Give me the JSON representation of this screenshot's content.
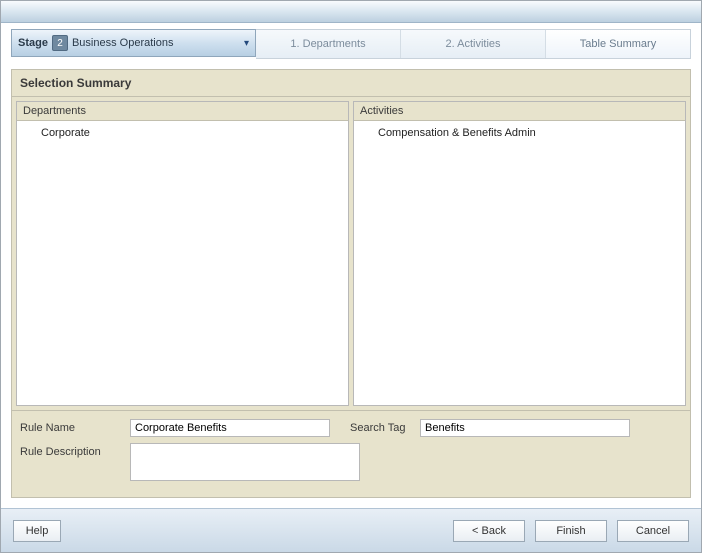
{
  "stage": {
    "label": "Stage",
    "number": "2",
    "text": "Business Operations"
  },
  "breadcrumbs": [
    {
      "label": "1. Departments",
      "active": false
    },
    {
      "label": "2. Activities",
      "active": false
    },
    {
      "label": "Table Summary",
      "active": true
    }
  ],
  "section_title": "Selection Summary",
  "columns": {
    "departments": {
      "header": "Departments",
      "items": [
        "Corporate"
      ]
    },
    "activities": {
      "header": "Activities",
      "items": [
        "Compensation & Benefits Admin"
      ]
    }
  },
  "form": {
    "rule_name_label": "Rule Name",
    "rule_name_value": "Corporate Benefits",
    "search_tag_label": "Search Tag",
    "search_tag_value": "Benefits",
    "rule_desc_label": "Rule Description",
    "rule_desc_value": ""
  },
  "buttons": {
    "help": "Help",
    "back": "< Back",
    "finish": "Finish",
    "cancel": "Cancel"
  }
}
